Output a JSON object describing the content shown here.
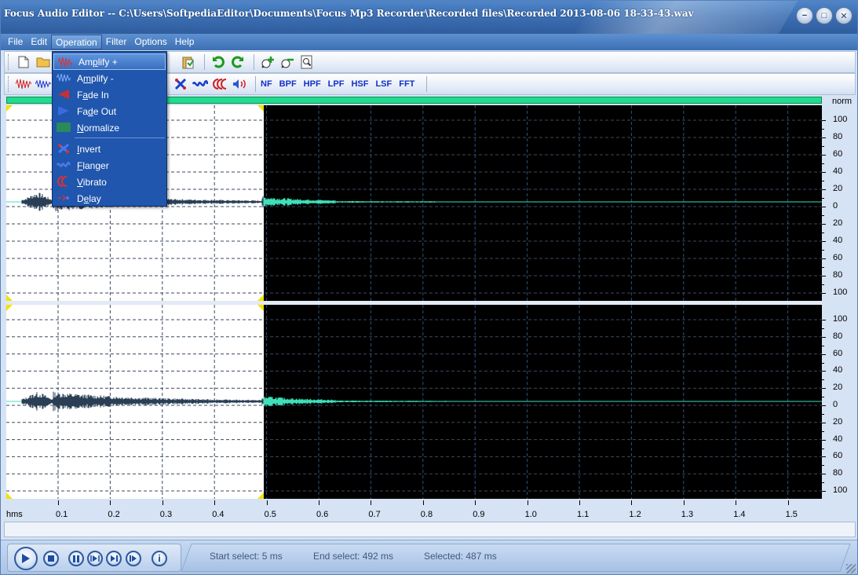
{
  "window": {
    "title": "Focus Audio Editor -- C:\\Users\\SoftpediaEditor\\Documents\\Focus Mp3 Recorder\\Recorded files\\Recorded 2013-08-06 18-33-43.wav"
  },
  "menubar": [
    "File",
    "Edit",
    "Operation",
    "Filter",
    "Options",
    "Help"
  ],
  "operation_menu": [
    {
      "label": "Amplify +",
      "icon": "amplify-plus-icon"
    },
    {
      "label": "Amplify -",
      "icon": "amplify-minus-icon"
    },
    {
      "label": "Fade In",
      "icon": "fade-in-icon"
    },
    {
      "label": "Fade Out",
      "icon": "fade-out-icon"
    },
    {
      "label": "Normalize",
      "icon": "normalize-icon"
    },
    {
      "label": "Invert",
      "icon": "invert-icon"
    },
    {
      "label": "Flanger",
      "icon": "flanger-icon"
    },
    {
      "label": "Vibrato",
      "icon": "vibrato-icon"
    },
    {
      "label": "Delay",
      "icon": "delay-icon"
    }
  ],
  "toolbar_filters": [
    "NF",
    "BPF",
    "HPF",
    "LPF",
    "HSF",
    "LSF",
    "FFT"
  ],
  "scale": {
    "header": "norm",
    "labels": [
      "100",
      "80",
      "60",
      "40",
      "20",
      "0",
      "20",
      "40",
      "60",
      "80",
      "100"
    ]
  },
  "timeline": {
    "unit": "hms",
    "labels": [
      "0.1",
      "0.2",
      "0.3",
      "0.4",
      "0.5",
      "0.6",
      "0.7",
      "0.8",
      "0.9",
      "1.0",
      "1.1",
      "1.2",
      "1.3",
      "1.4",
      "1.5"
    ]
  },
  "status": {
    "start_select": "Start select: 5 ms",
    "end_select": "End select: 492 ms",
    "selected": "Selected: 487 ms"
  },
  "colors": {
    "wave_selected": "#2a3f55",
    "wave_unselected": "#3fe0b8",
    "progress": "#1ede8e",
    "menu_bg": "#2056ad"
  }
}
